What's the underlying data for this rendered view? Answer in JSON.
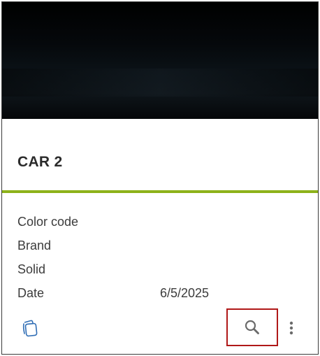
{
  "card": {
    "title": "CAR 2",
    "accent_color": "#8db21a",
    "properties": [
      {
        "label": "Color code",
        "value": ""
      },
      {
        "label": "Brand",
        "value": ""
      },
      {
        "label": "Solid",
        "value": ""
      },
      {
        "label": "Date",
        "value": "6/5/2025"
      }
    ]
  },
  "actions": {
    "left_icon": "document-stack-icon",
    "search_icon": "search-icon",
    "more_icon": "more-vertical-icon",
    "highlight_color": "#b01818"
  }
}
